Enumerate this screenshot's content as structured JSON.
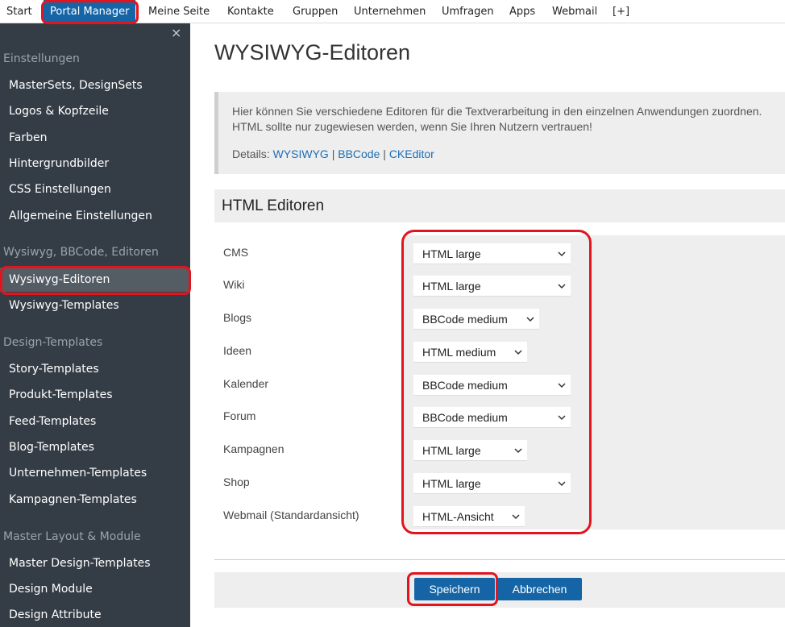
{
  "topnav": {
    "start": "Start",
    "portal_manager": "Portal Manager",
    "meine_seite": "Meine Seite",
    "kontakte": "Kontakte",
    "gruppen": "Gruppen",
    "unternehmen": "Unternehmen",
    "umfragen": "Umfragen",
    "apps": "Apps",
    "webmail": "Webmail",
    "more": "[+]"
  },
  "sidebar": {
    "close": "×",
    "einstellungen": "Einstellungen",
    "mastersets": "MasterSets, DesignSets",
    "logos": "Logos & Kopfzeile",
    "farben": "Farben",
    "hintergrund": "Hintergrundbilder",
    "css": "CSS Einstellungen",
    "allgemein": "Allgemeine Einstellungen",
    "wysiwyg_section": "Wysiwyg, BBCode, Editoren",
    "wysiwyg_editoren": "Wysiwyg-Editoren",
    "wysiwyg_templates": "Wysiwyg-Templates",
    "design_templates": "Design-Templates",
    "story": "Story-Templates",
    "produkt": "Produkt-Templates",
    "feed": "Feed-Templates",
    "blog": "Blog-Templates",
    "unternehmen": "Unternehmen-Templates",
    "kampagnen": "Kampagnen-Templates",
    "master_layout": "Master Layout & Module",
    "master_design": "Master Design-Templates",
    "design_module": "Design Module",
    "design_attribute": "Design Attribute"
  },
  "page": {
    "title": "WYSIWYG-Editoren",
    "info_line1": "Hier können Sie verschiedene Editoren für die Textverarbeitung in den einzelnen Anwendungen zuordnen.",
    "info_line2": "HTML sollte nur zugewiesen werden, wenn Sie Ihren Nutzern vertrauen!",
    "details_label": "Details:",
    "link_wysiwyg": "WYSIWYG",
    "link_bbcode": "BBCode",
    "link_ckeditor": "CKEditor",
    "sep": "|",
    "section_title": "HTML Editoren"
  },
  "fields": {
    "cms": {
      "label": "CMS",
      "value": "HTML large"
    },
    "wiki": {
      "label": "Wiki",
      "value": "HTML large"
    },
    "blogs": {
      "label": "Blogs",
      "value": "BBCode medium"
    },
    "ideen": {
      "label": "Ideen",
      "value": "HTML medium"
    },
    "kalender": {
      "label": "Kalender",
      "value": "BBCode medium"
    },
    "forum": {
      "label": "Forum",
      "value": "BBCode medium"
    },
    "kampagnen": {
      "label": "Kampagnen",
      "value": "HTML large"
    },
    "shop": {
      "label": "Shop",
      "value": "HTML large"
    },
    "webmail": {
      "label": "Webmail (Standardansicht)",
      "value": "HTML-Ansicht"
    }
  },
  "buttons": {
    "save": "Speichern",
    "cancel": "Abbrechen"
  },
  "colors": {
    "accent": "#1565a6",
    "sidebar_bg": "#343d46",
    "highlight": "#e2151e"
  }
}
